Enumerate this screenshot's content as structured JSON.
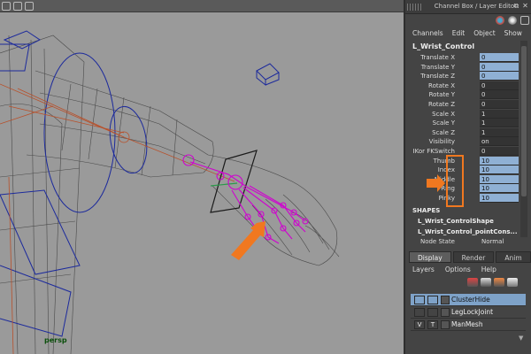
{
  "viewport": {
    "camera_label": "persp"
  },
  "panel": {
    "title": "Channel Box / Layer Editor",
    "menu": [
      "Channels",
      "Edit",
      "Object",
      "Show"
    ],
    "node_name": "L_Wrist_Control",
    "attributes": [
      {
        "label": "Translate X",
        "value": "0",
        "keyed": true
      },
      {
        "label": "Translate Y",
        "value": "0",
        "keyed": true
      },
      {
        "label": "Translate Z",
        "value": "0",
        "keyed": true
      },
      {
        "label": "Rotate X",
        "value": "0",
        "keyed": false
      },
      {
        "label": "Rotate Y",
        "value": "0",
        "keyed": false
      },
      {
        "label": "Rotate Z",
        "value": "0",
        "keyed": false
      },
      {
        "label": "Scale X",
        "value": "1",
        "keyed": false
      },
      {
        "label": "Scale Y",
        "value": "1",
        "keyed": false
      },
      {
        "label": "Scale Z",
        "value": "1",
        "keyed": false
      },
      {
        "label": "Visibility",
        "value": "on",
        "keyed": false
      },
      {
        "label": "IKor FKSwitch",
        "value": "0",
        "keyed": false
      },
      {
        "label": "Thumb",
        "value": "10",
        "keyed": true
      },
      {
        "label": "Index",
        "value": "10",
        "keyed": true
      },
      {
        "label": "Middle",
        "value": "10",
        "keyed": true
      },
      {
        "label": "Ring",
        "value": "10",
        "keyed": true
      },
      {
        "label": "Pinky",
        "value": "10",
        "keyed": true
      }
    ],
    "shapes_header": "SHAPES",
    "shapes": [
      "L_Wrist_ControlShape",
      "L_Wrist_Control_pointCons..."
    ],
    "node_state": {
      "label": "Node State",
      "value": "Normal"
    }
  },
  "layer_editor": {
    "tabs": [
      {
        "label": "Display",
        "active": true
      },
      {
        "label": "Render",
        "active": false
      },
      {
        "label": "Anim",
        "active": false
      }
    ],
    "menu": [
      "Layers",
      "Options",
      "Help"
    ],
    "layers": [
      {
        "name": "ClusterHide",
        "v": "",
        "t": "",
        "selected": true
      },
      {
        "name": "LegLockJoint",
        "v": "",
        "t": "",
        "selected": false
      },
      {
        "name": "ManMesh",
        "v": "V",
        "t": "T",
        "selected": false
      }
    ]
  },
  "colors": {
    "viewport_bg": "#9a9a9a",
    "keyed_field": "#8fb0d4",
    "selection": "#7ea2c8",
    "highlight_arrow": "#f07820",
    "ik_joint": "#d000d0"
  },
  "icons": {
    "scroll_down": "▼"
  }
}
